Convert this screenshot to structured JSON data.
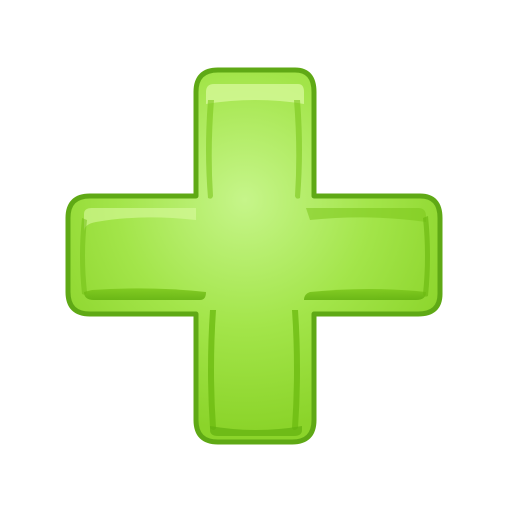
{
  "icon": {
    "name": "plus-icon",
    "colors": {
      "outline": "#5fa915",
      "fill_main": "#96dc34",
      "fill_light": "#c6f58a",
      "fill_dark": "#7cc71c",
      "ridge": "#6dbb12",
      "highlight": "#d8fa9e",
      "background": "#ffffff"
    }
  }
}
